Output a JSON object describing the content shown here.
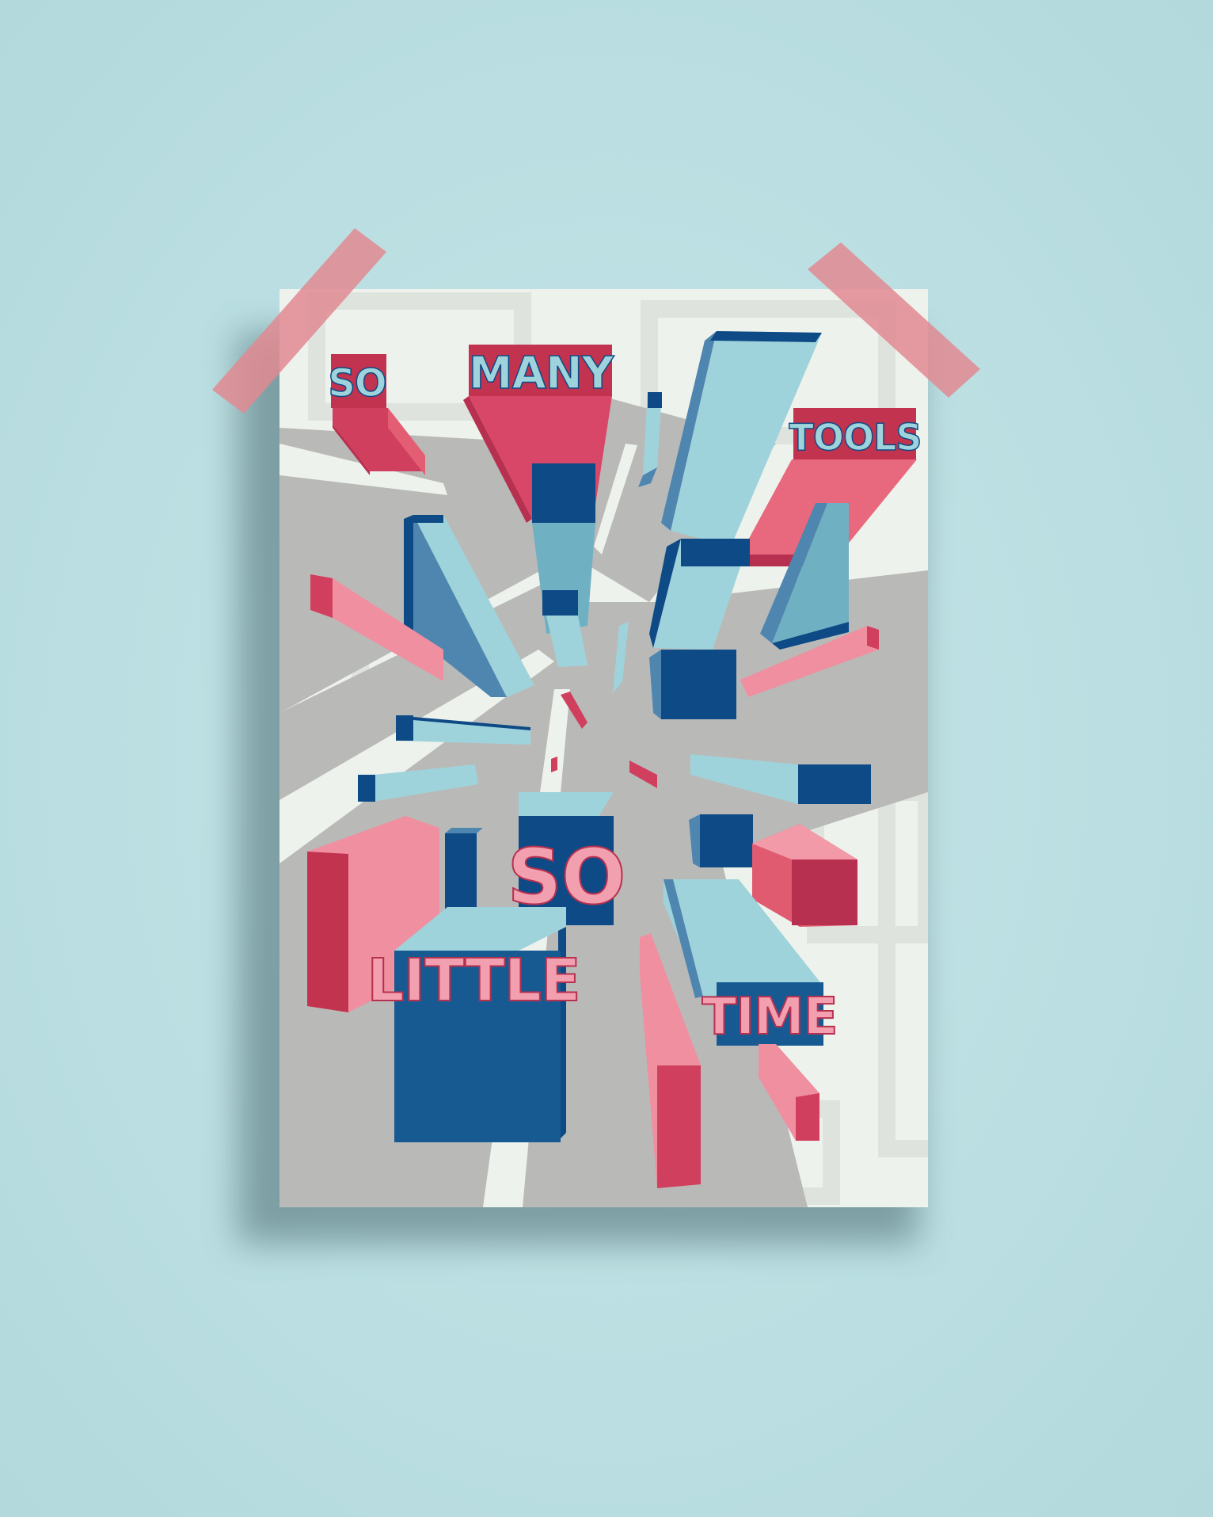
{
  "poster": {
    "line1_word1": "SO",
    "line1_word2": "MANY",
    "line1_word3": "TOOLS",
    "line2_word1": "SO",
    "line2_word2": "LITTLE",
    "line2_word3": "TIME"
  },
  "colors": {
    "wall": "#bde0e3",
    "paper": "#eef2ec",
    "gray": "#b9bab8",
    "navy": "#0e4a86",
    "light_blue": "#9fd3db",
    "mid_blue": "#4f86b0",
    "pink": "#ef8fa0",
    "red": "#d03f5e",
    "deep_red": "#b8304f",
    "tape": "#e08a92"
  }
}
